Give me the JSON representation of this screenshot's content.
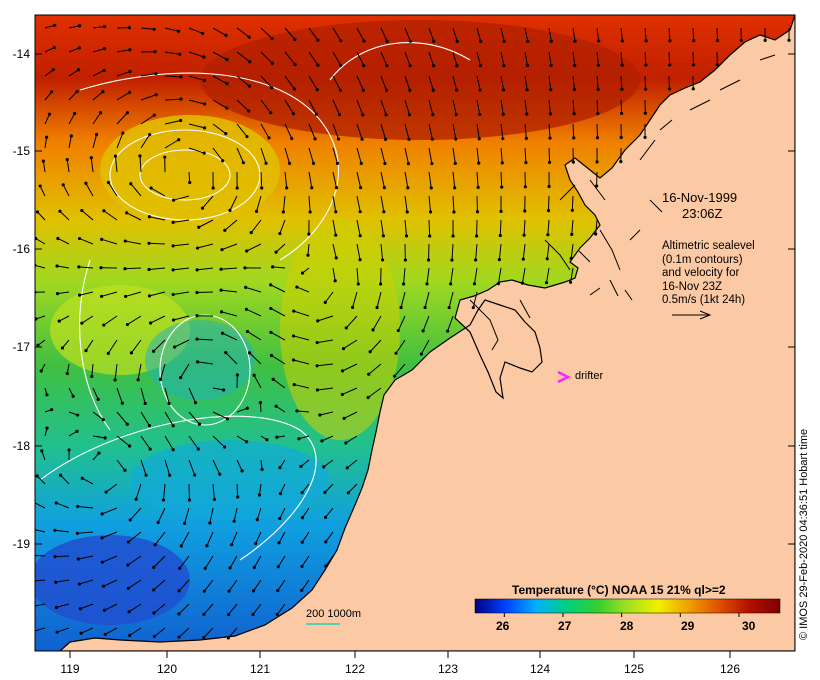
{
  "map": {
    "longitude_ticks": [
      "119",
      "120",
      "121",
      "122",
      "123",
      "124",
      "125",
      "126"
    ],
    "latitude_ticks": [
      "-14",
      "-15",
      "-16",
      "-17",
      "-18",
      "-19"
    ],
    "colors": {
      "land": "#fbc9a3",
      "coast": "#000000",
      "contour": "#ffffff",
      "drifter": "#ff22ff",
      "arrow": "#000000"
    }
  },
  "annotation": {
    "date": "16-Nov-1999",
    "time": "23:06Z",
    "altimetry_lines": [
      "Altimetric sealevel",
      "(0.1m contours)",
      "and velocity for",
      "16-Nov 23Z",
      "0.5m/s (1kt 24h)"
    ],
    "drifter_label": "drifter",
    "scale_bar_label": "200  1000m",
    "credit": "© IMOS 29-Feb-2020 04:36:51 Hobart time"
  },
  "colorbar": {
    "title": "Temperature (°C) NOAA 15 21% ql>=2",
    "labels": [
      "26",
      "27",
      "28",
      "29",
      "30"
    ],
    "range": [
      25.5,
      30.7
    ],
    "colors": [
      "#000080",
      "#0040ff",
      "#00b0ff",
      "#00d080",
      "#30d030",
      "#a0e020",
      "#f0f000",
      "#f0a000",
      "#e05000",
      "#b01000",
      "#800000"
    ]
  }
}
